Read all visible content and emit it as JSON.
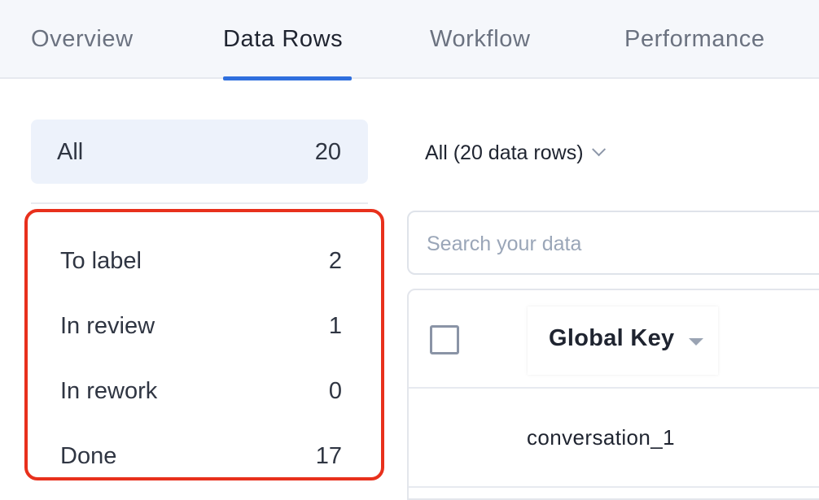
{
  "tabs": [
    {
      "label": "Overview",
      "active": false
    },
    {
      "label": "Data Rows",
      "active": true
    },
    {
      "label": "Workflow",
      "active": false
    },
    {
      "label": "Performance",
      "active": false
    }
  ],
  "filters": {
    "all": {
      "label": "All",
      "count": "20"
    },
    "statuses": [
      {
        "label": "To label",
        "count": "2"
      },
      {
        "label": "In review",
        "count": "1"
      },
      {
        "label": "In rework",
        "count": "0"
      },
      {
        "label": "Done",
        "count": "17"
      }
    ]
  },
  "dropdown": {
    "label": "All (20 data rows)",
    "icon": "chevron-down-icon"
  },
  "search": {
    "placeholder": "Search your data",
    "value": ""
  },
  "table": {
    "columns": [
      {
        "label": "Global Key",
        "icon": "sort-caret-icon"
      }
    ],
    "rows": [
      {
        "global_key": "conversation_1"
      }
    ]
  },
  "colors": {
    "accent": "#2f6fde",
    "highlight_border": "#e8301c",
    "selected_filter_bg": "#edf2fb"
  }
}
